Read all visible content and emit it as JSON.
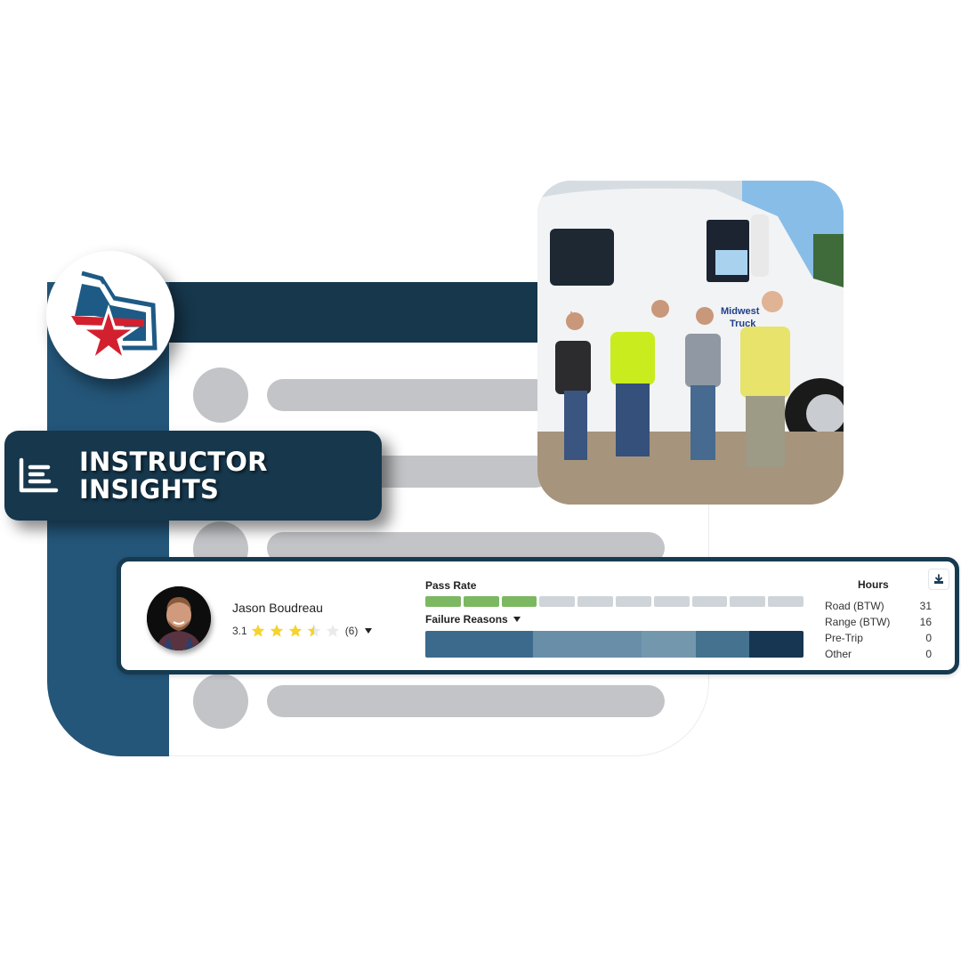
{
  "banner": {
    "icon": "bar-chart-icon",
    "title": "INSTRUCTOR\nINSIGHTS"
  },
  "logo": {
    "icon": "star-shield-logo",
    "colors": {
      "blue": "#1d5a86",
      "red": "#d3202f"
    }
  },
  "photo": {
    "description": "Four men standing in front of a white semi truck with 'Midwest Truck' lettering on the door"
  },
  "instructor": {
    "name": "Jason Boudreau",
    "rating": "3.1",
    "stars": {
      "full": 3,
      "half": 1,
      "empty": 1
    },
    "review_count": "(6)",
    "pass_rate": {
      "label": "Pass Rate",
      "filled_segments": 3,
      "total_segments": 10,
      "filled_color": "#7cb862",
      "empty_color": "#cfd4d9"
    },
    "failure_reasons": {
      "label": "Failure Reasons",
      "segments": [
        {
          "share": 2,
          "color": "#3b6a8c"
        },
        {
          "share": 2,
          "color": "#688ea8"
        },
        {
          "share": 1,
          "color": "#7397ad"
        },
        {
          "share": 1,
          "color": "#44728f"
        },
        {
          "share": 1,
          "color": "#173651"
        }
      ]
    },
    "hours": {
      "title": "Hours",
      "rows": [
        {
          "label": "Road (BTW)",
          "value": "31"
        },
        {
          "label": "Range (BTW)",
          "value": "16"
        },
        {
          "label": "Pre-Trip",
          "value": "0"
        },
        {
          "label": "Other",
          "value": "0"
        }
      ]
    },
    "download_icon": "download-icon"
  },
  "colors": {
    "sidebar": "#245679",
    "header": "#16374c",
    "placeholder": "#c3c4c7",
    "star": "#f6d32d",
    "star_empty": "#e9eaec"
  }
}
